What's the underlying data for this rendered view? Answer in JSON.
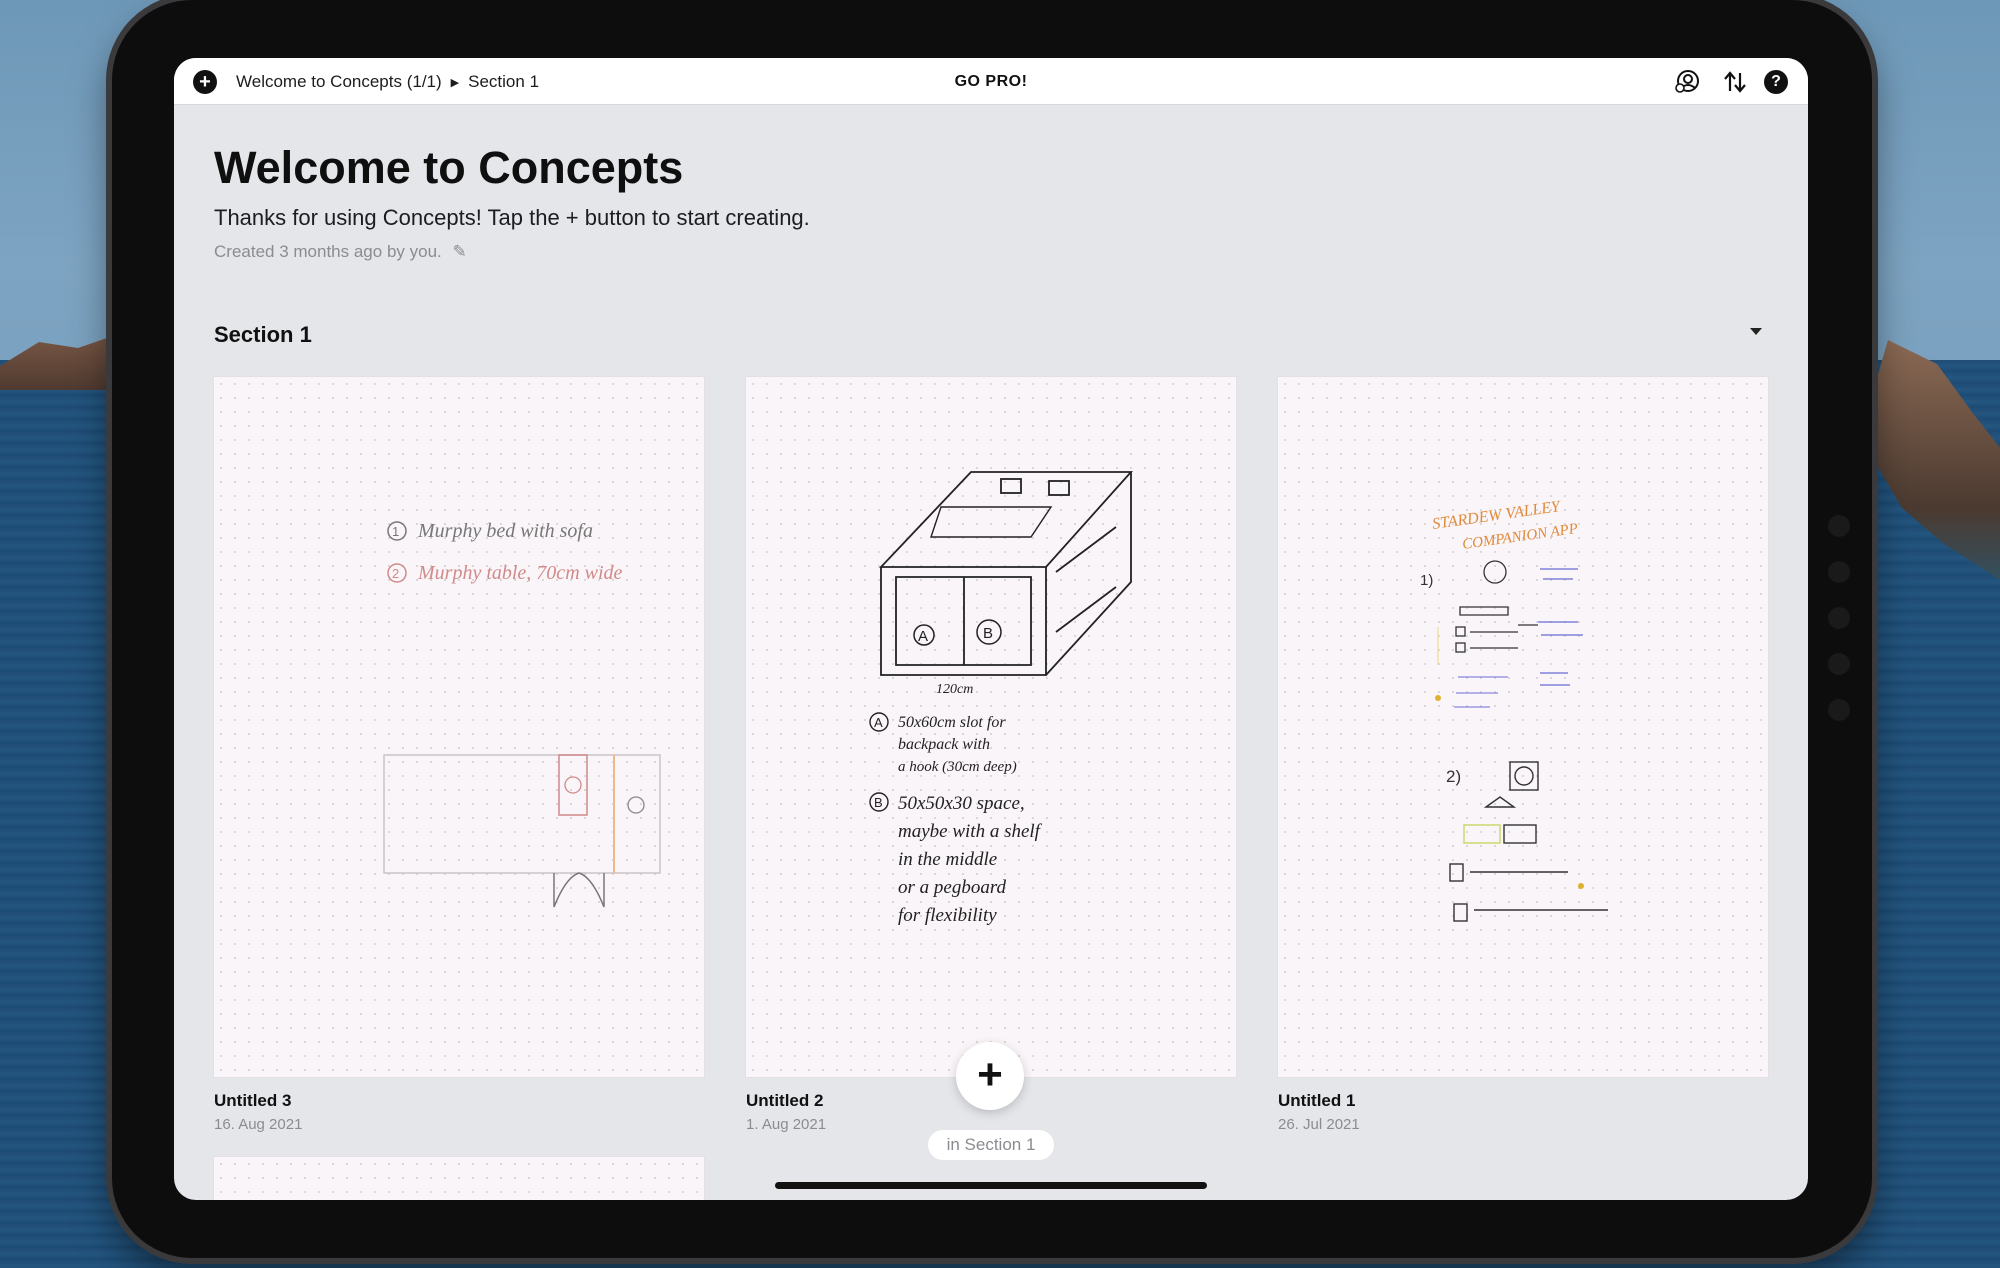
{
  "topbar": {
    "add_icon": "plus-circle-icon",
    "breadcrumb": {
      "gallery": "Welcome to Concepts  (1/1)",
      "section": "Section 1"
    },
    "go_pro": "GO PRO!",
    "icons": [
      "account-icon",
      "sort-icon",
      "help-icon"
    ]
  },
  "header": {
    "title": "Welcome to Concepts",
    "subtitle": "Thanks for using Concepts! Tap the + button to start creating.",
    "meta": "Created 3 months ago by you."
  },
  "section": {
    "title": "Section 1"
  },
  "drawings": [
    {
      "name": "Untitled 3",
      "date": "16. Aug 2021"
    },
    {
      "name": "Untitled 2",
      "date": "1. Aug 2021"
    },
    {
      "name": "Untitled 1",
      "date": "26. Jul 2021"
    }
  ],
  "sketch_text": {
    "untitled3_line1": "Murphy bed with sofa",
    "untitled3_line2": "Murphy table, 70cm wide",
    "untitled2_line1": "50x60cm slot for",
    "untitled2_line2": "backpack with",
    "untitled2_line3": "a hook (30cm deep)",
    "untitled2_line4": "50x50x30 space,",
    "untitled2_line5": "maybe with a shelf",
    "untitled2_line6": "in the middle",
    "untitled2_line7": "or a pegboard",
    "untitled2_line8": "for flexibility",
    "untitled2_dim": "120cm",
    "untitled1_title1": "STARDEW VALLEY",
    "untitled1_title2": "COMPANION APP"
  },
  "fab": {
    "label": "in Section 1"
  }
}
